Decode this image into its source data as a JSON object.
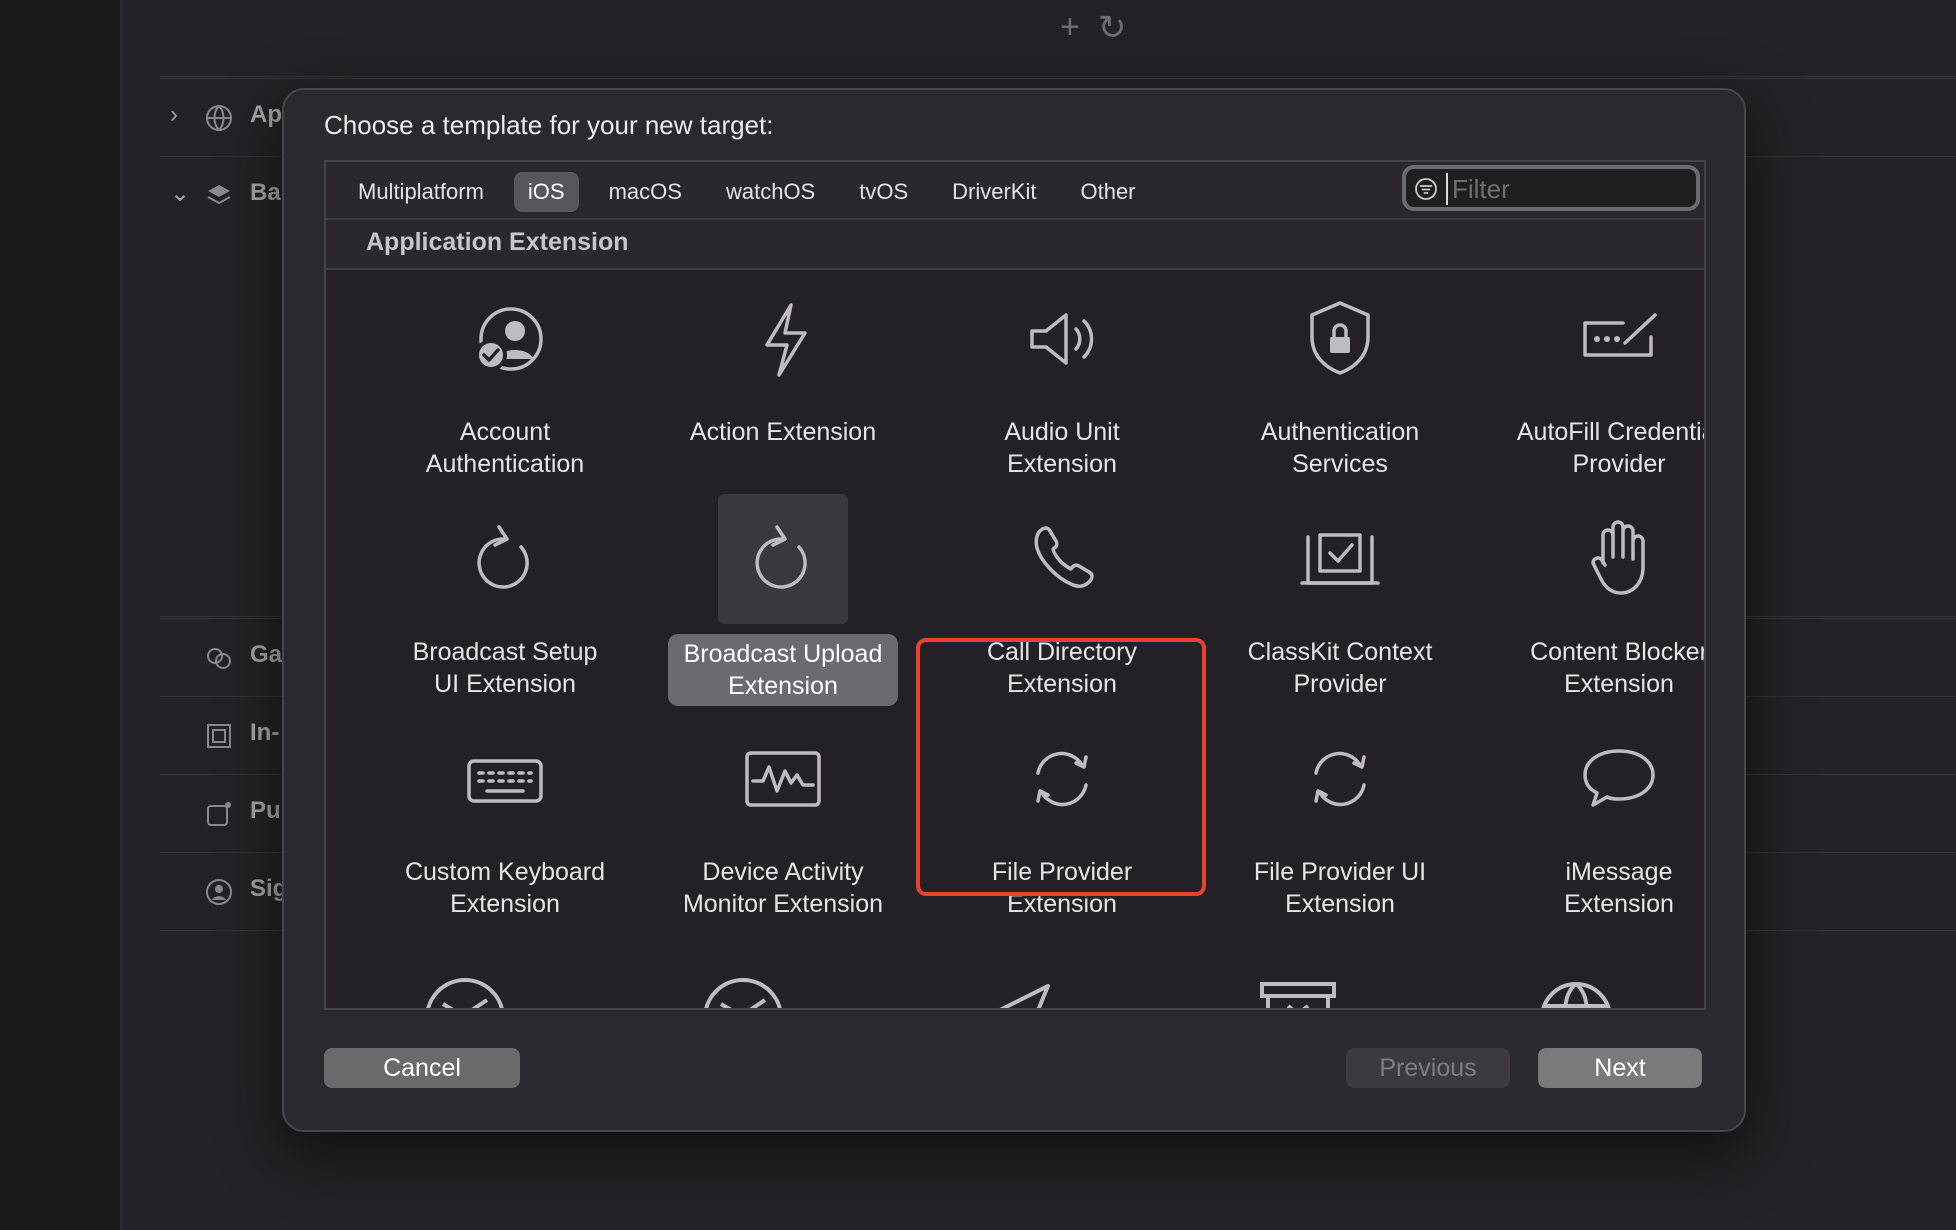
{
  "dialog": {
    "title": "Choose a template for your new target:",
    "tabs": [
      "Multiplatform",
      "iOS",
      "macOS",
      "watchOS",
      "tvOS",
      "DriverKit",
      "Other"
    ],
    "active_tab": "iOS",
    "filter_placeholder": "Filter",
    "section": "Application Extension",
    "selected_template": "Broadcast Upload Extension",
    "templates": [
      {
        "label": "Account\nAuthentication",
        "icon": "account-check-icon"
      },
      {
        "label": "Action Extension",
        "icon": "lightning-icon"
      },
      {
        "label": "Audio Unit\nExtension",
        "icon": "speaker-icon"
      },
      {
        "label": "Authentication\nServices",
        "icon": "lock-shield-icon"
      },
      {
        "label": "AutoFill Credential\nProvider",
        "icon": "password-field-icon"
      },
      {
        "label": "Broadcast Setup\nUI Extension",
        "icon": "circular-arrow-icon"
      },
      {
        "label": "Broadcast Upload\nExtension",
        "icon": "circular-arrow-icon"
      },
      {
        "label": "Call Directory\nExtension",
        "icon": "phone-icon"
      },
      {
        "label": "ClassKit Context\nProvider",
        "icon": "checkbox-tray-icon"
      },
      {
        "label": "Content Blocker\nExtension",
        "icon": "hand-icon"
      },
      {
        "label": "Custom Keyboard\nExtension",
        "icon": "keyboard-icon"
      },
      {
        "label": "Device Activity\nMonitor Extension",
        "icon": "activity-wave-icon"
      },
      {
        "label": "File Provider\nExtension",
        "icon": "sync-arrows-icon"
      },
      {
        "label": "File Provider UI\nExtension",
        "icon": "sync-arrows-icon"
      },
      {
        "label": "iMessage\nExtension",
        "icon": "speech-bubble-icon"
      }
    ],
    "buttons": {
      "cancel": "Cancel",
      "previous": "Previous",
      "next": "Next"
    }
  },
  "background": {
    "sidebar_rows": [
      "Ap",
      "Ba",
      "Ga",
      "In-",
      "Pu",
      "Sig"
    ]
  }
}
